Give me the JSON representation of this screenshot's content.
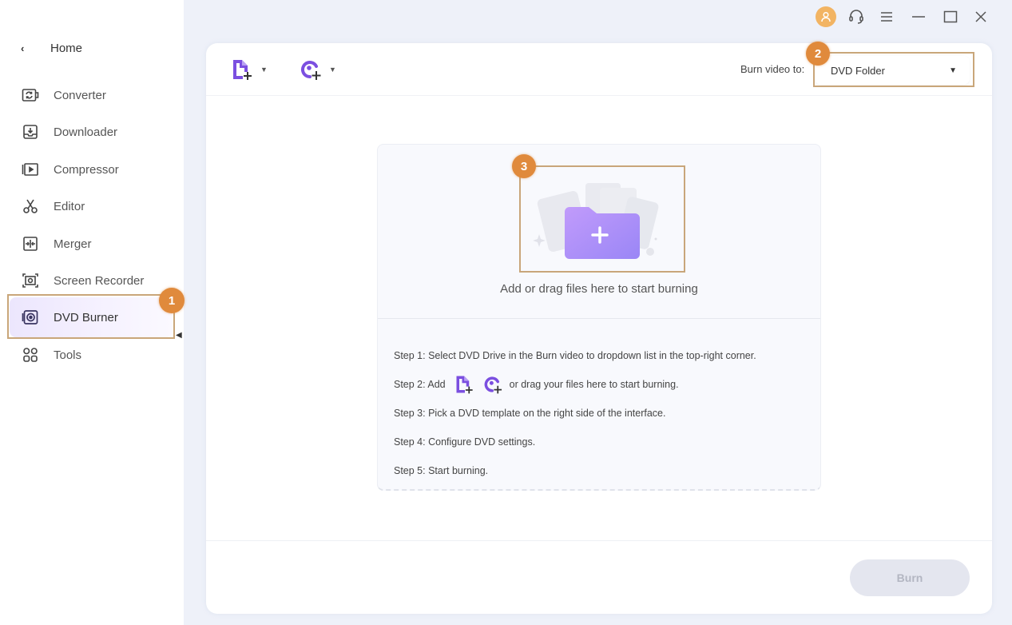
{
  "sidebar": {
    "home_label": "Home",
    "items": [
      {
        "id": "converter",
        "label": "Converter",
        "icon": "converter-icon"
      },
      {
        "id": "downloader",
        "label": "Downloader",
        "icon": "downloader-icon"
      },
      {
        "id": "compressor",
        "label": "Compressor",
        "icon": "compressor-icon"
      },
      {
        "id": "editor",
        "label": "Editor",
        "icon": "scissors-icon"
      },
      {
        "id": "merger",
        "label": "Merger",
        "icon": "merger-icon"
      },
      {
        "id": "screen-recorder",
        "label": "Screen Recorder",
        "icon": "screen-recorder-icon"
      },
      {
        "id": "dvd-burner",
        "label": "DVD Burner",
        "icon": "dvd-icon",
        "active": true
      },
      {
        "id": "tools",
        "label": "Tools",
        "icon": "tools-grid-icon"
      }
    ]
  },
  "annotations": {
    "badge1": "1",
    "badge2": "2",
    "badge3": "3",
    "highlight_color": "#c9a67a",
    "badge_color": "#e08a3c"
  },
  "toolbar": {
    "add_files_icon": "add-file-icon",
    "add_disc_icon": "add-disc-icon",
    "burn_to_label": "Burn video to:",
    "burn_to_value": "DVD Folder"
  },
  "dropzone": {
    "text": "Add or drag files here to start burning",
    "steps": {
      "s1": "Step 1: Select DVD Drive in the Burn video to dropdown list in the top-right corner.",
      "s2_prefix": "Step 2: Add",
      "s2_suffix": "or drag your files here to start burning.",
      "s3": "Step 3: Pick a DVD template on the right side of the interface.",
      "s4": "Step 4: Configure DVD settings.",
      "s5": "Step 5: Start burning."
    }
  },
  "footer": {
    "burn_label": "Burn",
    "burn_enabled": false
  },
  "colors": {
    "accent": "#7b4fe0",
    "folder": "#a98bf7"
  }
}
